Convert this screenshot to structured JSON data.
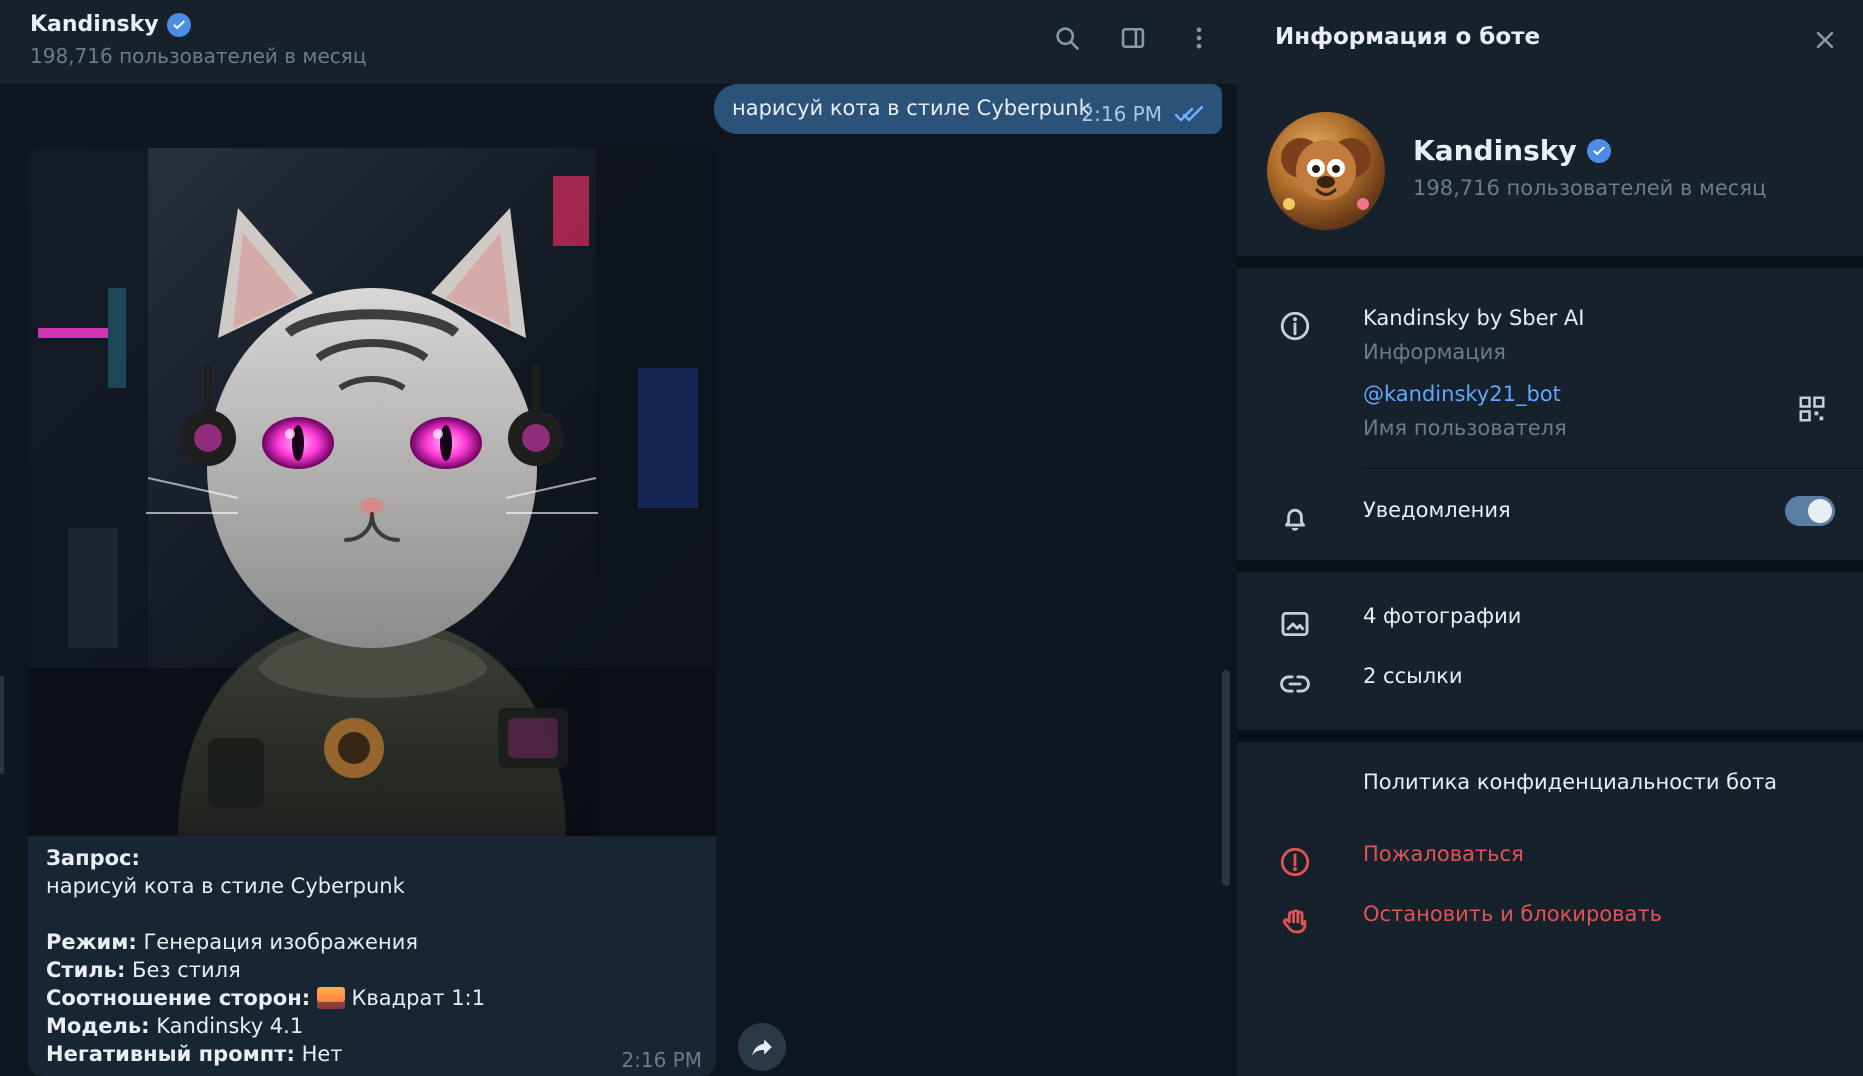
{
  "colors": {
    "accent": "#4c8ee6",
    "danger": "#e05454",
    "link": "#5fa8ff"
  },
  "chat": {
    "header": {
      "title": "Kandinsky",
      "subtitle": "198,716 пользователей в месяц",
      "icons": [
        "search-icon",
        "sidebar-toggle-icon",
        "more-vertical-icon"
      ]
    },
    "outgoing": {
      "text": "нарисуй кота в стиле Cyberpunk",
      "time": "2:16 PM"
    },
    "incoming": {
      "caption": {
        "request_label": "Запрос:",
        "request_text": "нарисуй кота в стиле Cyberpunk",
        "mode_label": "Режим:",
        "mode_value": "Генерация изображения",
        "style_label": "Стиль:",
        "style_value": "Без стиля",
        "ratio_label": "Соотношение сторон:",
        "ratio_value": "Квадрат 1:1",
        "model_label": "Модель:",
        "model_value": "Kandinsky 4.1",
        "neg_label": "Негативный промпт:",
        "neg_value": "Нет"
      },
      "time": "2:16 PM"
    }
  },
  "info": {
    "title": "Информация о боте",
    "profile": {
      "name": "Kandinsky",
      "subtitle": "198,716 пользователей в месяц"
    },
    "about": {
      "text": "Kandinsky by Sber AI",
      "label": "Информация"
    },
    "username": {
      "text": "@kandinsky21_bot",
      "label": "Имя пользователя"
    },
    "notifications": {
      "label": "Уведомления",
      "enabled": true
    },
    "media": {
      "photos": "4 фотографии",
      "links": "2 ссылки"
    },
    "privacy": "Политика конфиденциальности бота",
    "report": "Пожаловаться",
    "block": "Остановить и блокировать"
  }
}
